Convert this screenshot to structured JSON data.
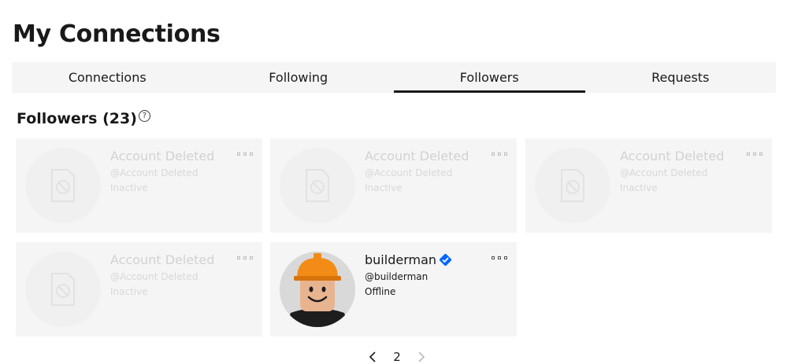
{
  "page": {
    "title": "My Connections"
  },
  "tabs": [
    {
      "label": "Connections"
    },
    {
      "label": "Following"
    },
    {
      "label": "Followers"
    },
    {
      "label": "Requests"
    }
  ],
  "active_tab": "Followers",
  "section": {
    "title": "Followers (23)",
    "help_icon": "?"
  },
  "cards": [
    {
      "name": "Account Deleted",
      "handle": "@Account Deleted",
      "status": "Inactive"
    },
    {
      "name": "Account Deleted",
      "handle": "@Account Deleted",
      "status": "Inactive"
    },
    {
      "name": "Account Deleted",
      "handle": "@Account Deleted",
      "status": "Inactive"
    },
    {
      "name": "Account Deleted",
      "handle": "@Account Deleted",
      "status": "Inactive"
    },
    {
      "name": "builderman",
      "handle": "@builderman",
      "status": "Offline",
      "verified": true
    }
  ],
  "pagination": {
    "current_page": "2"
  },
  "colors": {
    "accent": "#0066ff",
    "background": "#f5f5f5",
    "text": "#191919",
    "muted": "#d2d2d2"
  },
  "icons": {
    "help": "question-circle-icon",
    "more": "more-options-icon",
    "verified": "verified-badge-icon",
    "prev": "chevron-left-icon",
    "next": "chevron-right-icon",
    "deleted": "deleted-file-icon"
  }
}
